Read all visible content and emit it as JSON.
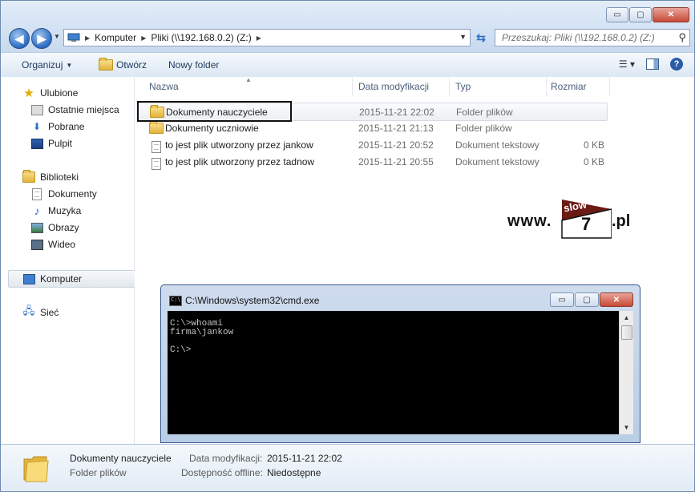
{
  "window": {
    "caption_buttons": {
      "minimize": "▭",
      "maximize": "▢",
      "close": "✕"
    }
  },
  "address_bar": {
    "crumbs": [
      "Komputer",
      "Pliki (\\\\192.168.0.2) (Z:)"
    ],
    "search_placeholder": "Przeszukaj: Pliki (\\\\192.168.0.2) (Z:)"
  },
  "toolbar": {
    "organize": "Organizuj",
    "open": "Otwórz",
    "new_folder": "Nowy folder"
  },
  "nav": {
    "favorites": "Ulubione",
    "recent": "Ostatnie miejsca",
    "downloads": "Pobrane",
    "desktop": "Pulpit",
    "libraries": "Biblioteki",
    "documents": "Dokumenty",
    "music": "Muzyka",
    "pictures": "Obrazy",
    "video": "Wideo",
    "computer": "Komputer",
    "network": "Sieć"
  },
  "columns": {
    "name": "Nazwa",
    "date": "Data modyfikacji",
    "type": "Typ",
    "size": "Rozmiar"
  },
  "files": [
    {
      "name": "Dokumenty nauczyciele",
      "date": "2015-11-21 22:02",
      "type": "Folder plików",
      "size": "",
      "icon": "folder-icon"
    },
    {
      "name": "Dokumenty uczniowie",
      "date": "2015-11-21 21:13",
      "type": "Folder plików",
      "size": "",
      "icon": "folder-icon"
    },
    {
      "name": "to jest plik utworzony przez jankow",
      "date": "2015-11-21 20:52",
      "type": "Dokument tekstowy",
      "size": "0 KB",
      "icon": "text-file-icon"
    },
    {
      "name": "to jest plik utworzony przez tadnow",
      "date": "2015-11-21 20:55",
      "type": "Dokument tekstowy",
      "size": "0 KB",
      "icon": "text-file-icon"
    }
  ],
  "logo": {
    "prefix": "www.",
    "slow": "slow",
    "seven": "7",
    "suffix": ".pl"
  },
  "cmd": {
    "title": "C:\\Windows\\system32\\cmd.exe",
    "icon_text": "C:\\",
    "lines": [
      "C:\\>whoami",
      "firma\\jankow",
      "",
      "C:\\>"
    ]
  },
  "details": {
    "name": "Dokumenty nauczyciele",
    "type": "Folder plików",
    "date_label": "Data modyfikacji:",
    "date_value": "2015-11-21 22:02",
    "offline_label": "Dostępność offline:",
    "offline_value": "Niedostępne"
  },
  "colors": {
    "selection_outline": "#111111",
    "console_bg": "#000000",
    "console_fg": "#c0c0c0"
  }
}
